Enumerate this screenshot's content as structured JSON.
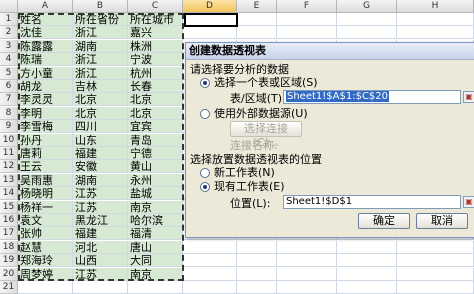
{
  "columns": [
    "A",
    "B",
    "C",
    "D",
    "E",
    "F",
    "G",
    "H"
  ],
  "rows": [
    [
      "姓名",
      "所在省份",
      "所在城市"
    ],
    [
      "沈佳",
      "浙江",
      "嘉兴"
    ],
    [
      "陈露露",
      "湖南",
      "株洲"
    ],
    [
      "陈瑞",
      "浙江",
      "宁波"
    ],
    [
      "方小童",
      "浙江",
      "杭州"
    ],
    [
      "胡龙",
      "吉林",
      "长春"
    ],
    [
      "李灵灵",
      "北京",
      "北京"
    ],
    [
      "李明",
      "北京",
      "北京"
    ],
    [
      "李雪梅",
      "四川",
      "宜宾"
    ],
    [
      "孙丹",
      "山东",
      "青岛"
    ],
    [
      "唐莉",
      "福建",
      "宁德"
    ],
    [
      "王云",
      "安徽",
      "黄山"
    ],
    [
      "吴雨惠",
      "湖南",
      "永州"
    ],
    [
      "杨晓明",
      "江苏",
      "盐城"
    ],
    [
      "杨祥一",
      "江苏",
      "南京"
    ],
    [
      "袁文",
      "黑龙江",
      "哈尔滨"
    ],
    [
      "张帅",
      "福建",
      "福清"
    ],
    [
      "赵慧",
      "河北",
      "唐山"
    ],
    [
      "郑海玲",
      "山西",
      "大同"
    ],
    [
      "周梦婷",
      "江苏",
      "南京"
    ]
  ],
  "dialog": {
    "title": "创建数据透视表",
    "section1": "请选择要分析的数据",
    "opt_range": "选择一个表或区域(S)",
    "range_label": "表/区域(T):",
    "range_value": "Sheet1!$A$1:$C$20",
    "opt_external": "使用外部数据源(U)",
    "choose_conn": "选择连接(C)...",
    "conn_name": "连接名称:",
    "section2": "选择放置数据透视表的位置",
    "opt_new": "新工作表(N)",
    "opt_existing": "现有工作表(E)",
    "location_label": "位置(L):",
    "location_value": "Sheet1!$D$1",
    "ok": "确定",
    "cancel": "取消"
  },
  "colors": {
    "selection_fill": "#d6ead3",
    "title_fill": "#c7d3ea",
    "dialog_bg": "#ece9d8"
  }
}
